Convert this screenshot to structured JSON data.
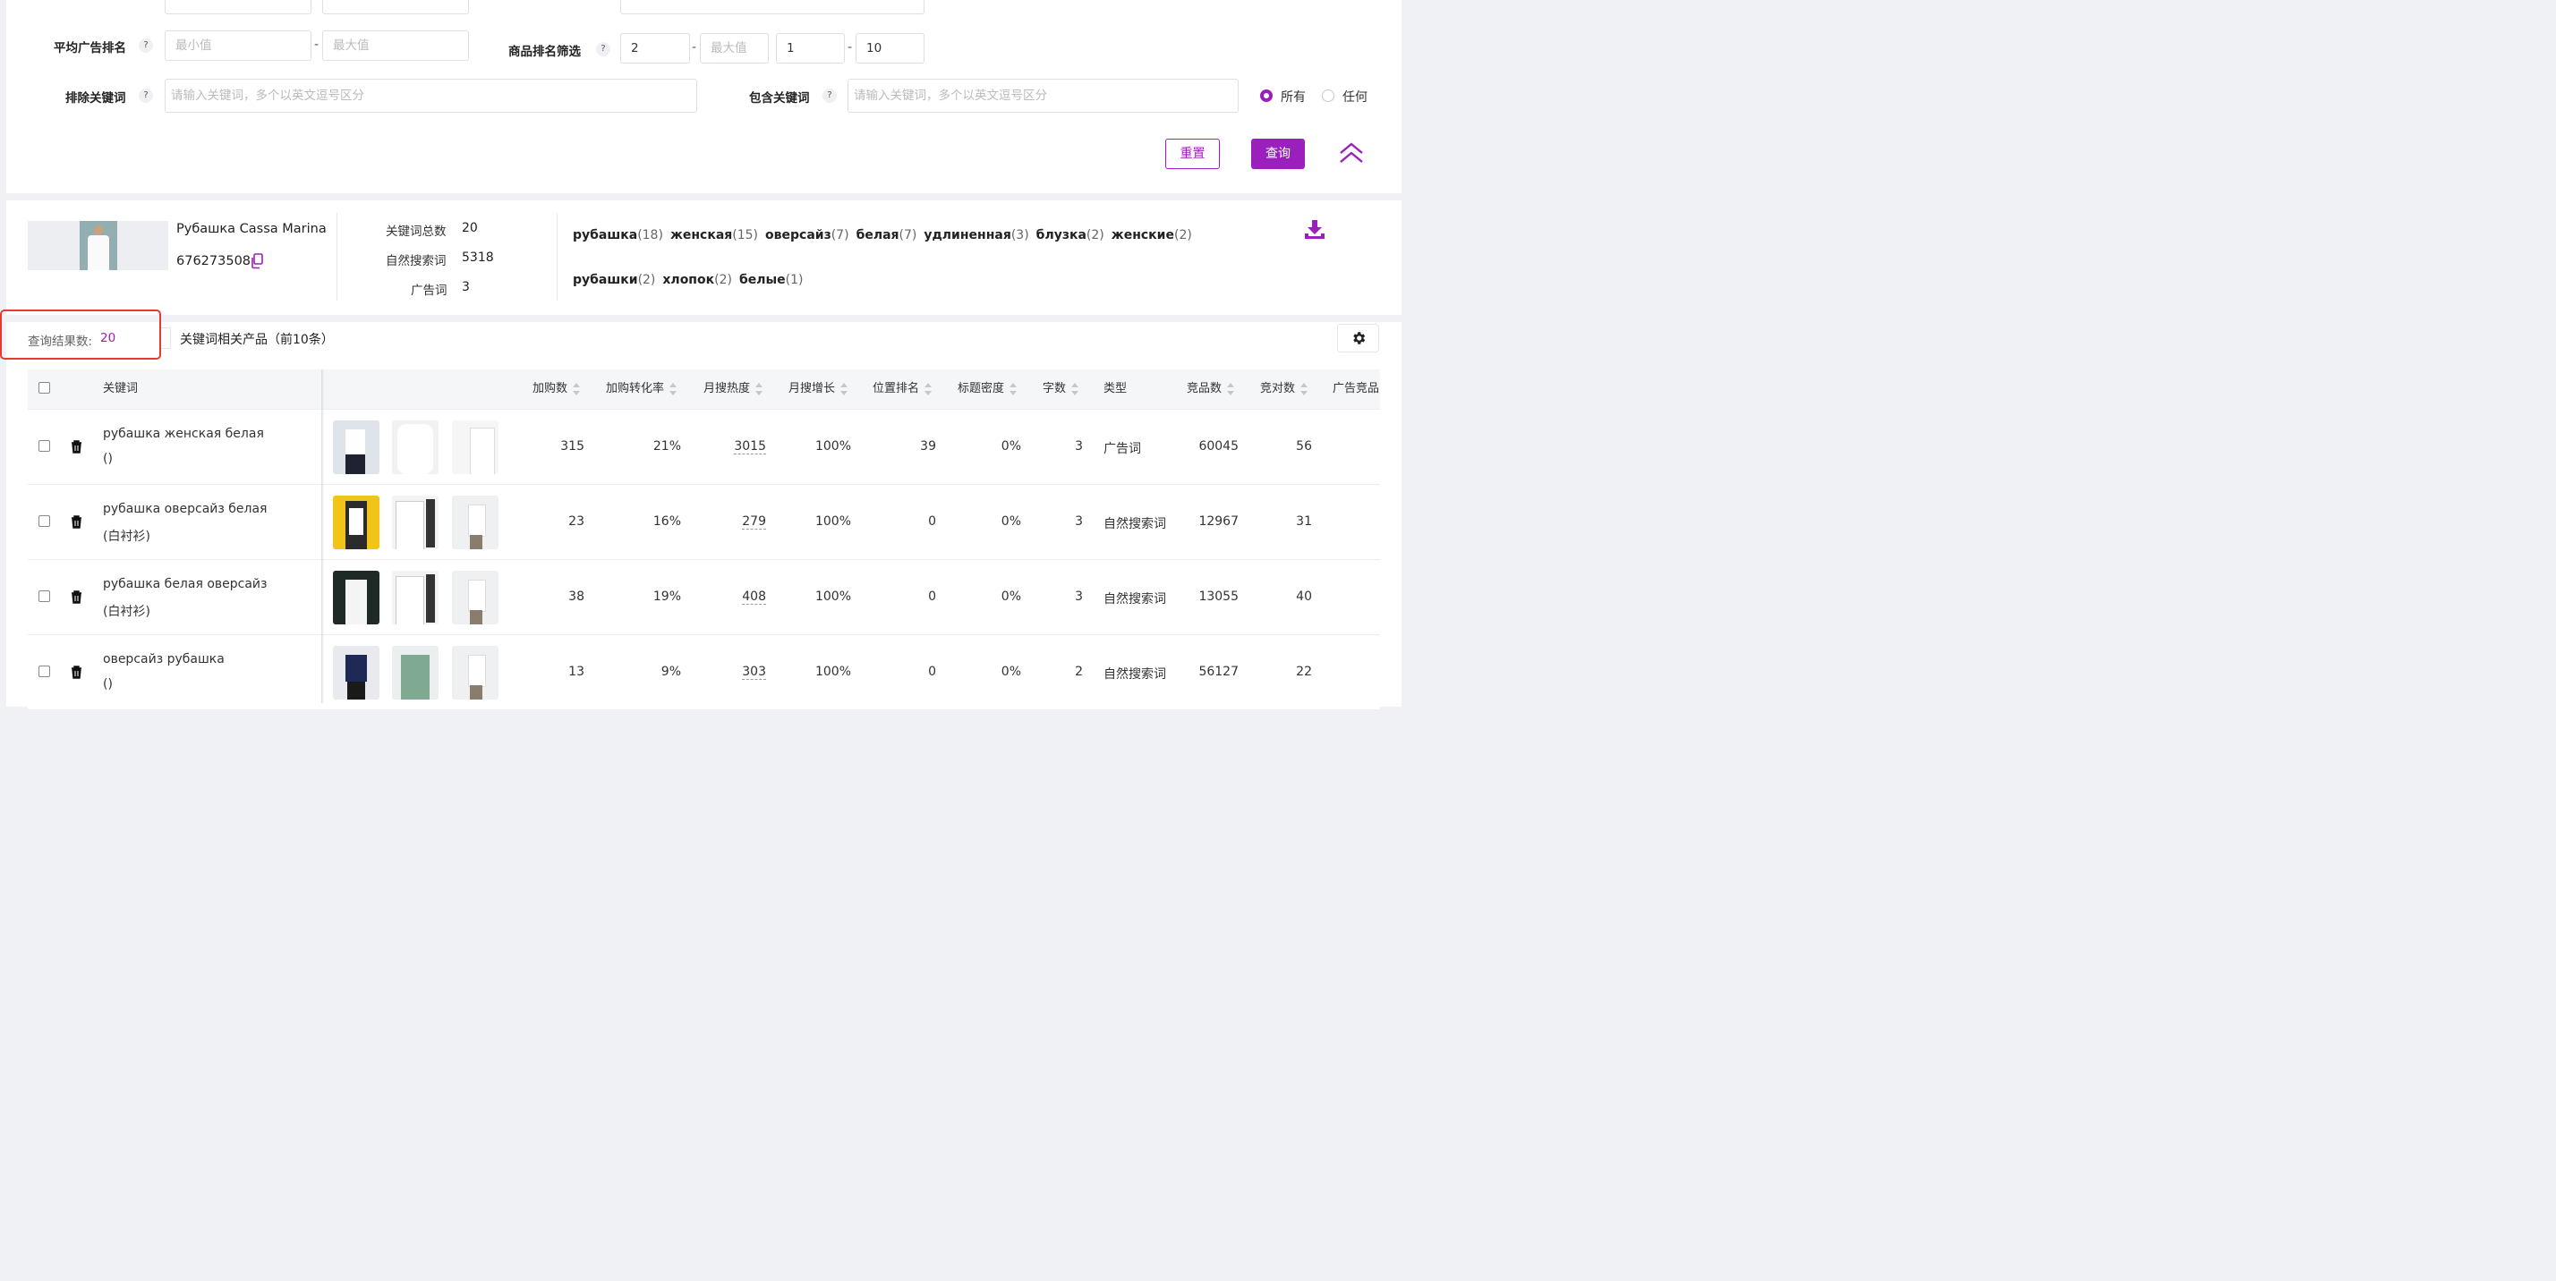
{
  "filters": {
    "avg_ad_rank_label": "平均广告排名",
    "min_placeholder": "最小值",
    "max_placeholder": "最大值",
    "product_rank_label": "商品排名筛选",
    "product_rank_from": "2",
    "product_rank_to_placeholder": "最大值",
    "page_from": "1",
    "page_to": "10",
    "exclude_label": "排除关键词",
    "exclude_placeholder": "请输入关键词，多个以英文逗号区分",
    "include_label": "包含关键词",
    "include_placeholder": "请输入关键词，多个以英文逗号区分",
    "radio_all": "所有",
    "radio_any": "任何",
    "reset": "重置",
    "search": "查询",
    "help": "?"
  },
  "product": {
    "name": "Рубашка Cassa Marina",
    "id": "676273508",
    "stats": [
      {
        "label": "关键词总数",
        "value": "20"
      },
      {
        "label": "自然搜索词",
        "value": "5318"
      },
      {
        "label": "广告词",
        "value": "3"
      }
    ],
    "keywords": [
      {
        "word": "рубашка",
        "count": "(18)"
      },
      {
        "word": "женская",
        "count": "(15)"
      },
      {
        "word": "оверсайз",
        "count": "(7)"
      },
      {
        "word": "белая",
        "count": "(7)"
      },
      {
        "word": "удлиненная",
        "count": "(3)"
      },
      {
        "word": "блузка",
        "count": "(2)"
      },
      {
        "word": "женские",
        "count": "(2)"
      },
      {
        "word": "рубашки",
        "count": "(2)"
      },
      {
        "word": "хлопок",
        "count": "(2)"
      },
      {
        "word": "белые",
        "count": "(1)"
      }
    ]
  },
  "results": {
    "count_label": "查询结果数:",
    "count_value": "20",
    "related_label": "关键词相关产品（前10条）"
  },
  "table": {
    "headers": {
      "keyword": "关键词",
      "cart": "加购数",
      "cart_rate": "加购转化率",
      "monthly_heat": "月搜热度",
      "monthly_growth": "月搜增长",
      "position_rank": "位置排名",
      "title_density": "标题密度",
      "word_count": "字数",
      "type": "类型",
      "competitors": "竞品数",
      "bid_count": "竞对数",
      "ad_competitors": "广告竞品"
    },
    "rows": [
      {
        "keyword": "рубашка женская белая",
        "translation": "()",
        "cart": "315",
        "cart_rate": "21%",
        "heat": "3015",
        "growth": "100%",
        "rank": "39",
        "density": "0%",
        "words": "3",
        "type": "广告词",
        "competitors": "60045",
        "bids": "56"
      },
      {
        "keyword": "рубашка оверсайз белая",
        "translation": "(白衬衫)",
        "cart": "23",
        "cart_rate": "16%",
        "heat": "279",
        "growth": "100%",
        "rank": "0",
        "density": "0%",
        "words": "3",
        "type": "自然搜索词",
        "competitors": "12967",
        "bids": "31"
      },
      {
        "keyword": "рубашка белая оверсайз",
        "translation": "(白衬衫)",
        "cart": "38",
        "cart_rate": "19%",
        "heat": "408",
        "growth": "100%",
        "rank": "0",
        "density": "0%",
        "words": "3",
        "type": "自然搜索词",
        "competitors": "13055",
        "bids": "40"
      },
      {
        "keyword": "оверсайз рубашка",
        "translation": "()",
        "cart": "13",
        "cart_rate": "9%",
        "heat": "303",
        "growth": "100%",
        "rank": "0",
        "density": "0%",
        "words": "2",
        "type": "自然搜索词",
        "competitors": "56127",
        "bids": "22"
      }
    ]
  },
  "colors": {
    "accent": "#9b1fbd",
    "highlight_box": "#e53935"
  },
  "icons": [
    "copy-icon",
    "download-icon",
    "collapse-up-icon",
    "gear-icon",
    "trash-icon"
  ]
}
